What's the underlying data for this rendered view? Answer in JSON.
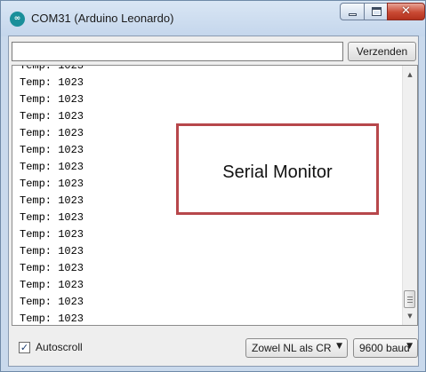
{
  "window": {
    "title": "COM31 (Arduino Leonardo)",
    "icon": "arduino-infinity-icon",
    "controls": {
      "minimize": "minimize-icon",
      "maximize": "maximize-icon",
      "close": "close-icon"
    }
  },
  "send_bar": {
    "input_value": "",
    "send_label": "Verzenden"
  },
  "output": {
    "lines": [
      "Temp: 1023",
      "Temp: 1023",
      "Temp: 1023",
      "Temp: 1023",
      "Temp: 1023",
      "Temp: 1023",
      "Temp: 1023",
      "Temp: 1023",
      "Temp: 1023",
      "Temp: 1023",
      "Temp: 1023",
      "Temp: 1023",
      "Temp: 1023",
      "Temp: 1023",
      "Temp: 1023",
      "Temp: 1023"
    ]
  },
  "footer": {
    "autoscroll_label": "Autoscroll",
    "autoscroll_checked": true,
    "line_ending": "Zowel NL als CR",
    "baud_rate": "9600 baud"
  },
  "annotation": {
    "label": "Serial Monitor",
    "border_color": "#b7474b"
  },
  "colors": {
    "close_button": "#c94a34",
    "title_bar": "#c9d9ec"
  }
}
